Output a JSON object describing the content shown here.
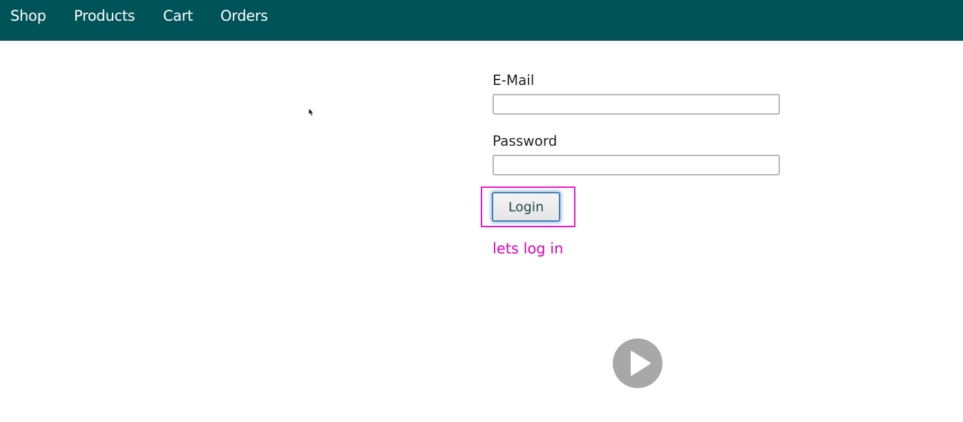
{
  "nav": {
    "items": [
      {
        "label": "Shop"
      },
      {
        "label": "Products"
      },
      {
        "label": "Cart"
      },
      {
        "label": "Orders"
      }
    ],
    "background_color": "#005457"
  },
  "form": {
    "email": {
      "label": "E-Mail",
      "value": ""
    },
    "password": {
      "label": "Password",
      "value": ""
    },
    "login_label": "Login"
  },
  "annotation": {
    "text": "lets log in",
    "color": "#dd00bb"
  },
  "icons": {
    "cursor": "mouse-pointer-icon",
    "video": "play-icon"
  }
}
